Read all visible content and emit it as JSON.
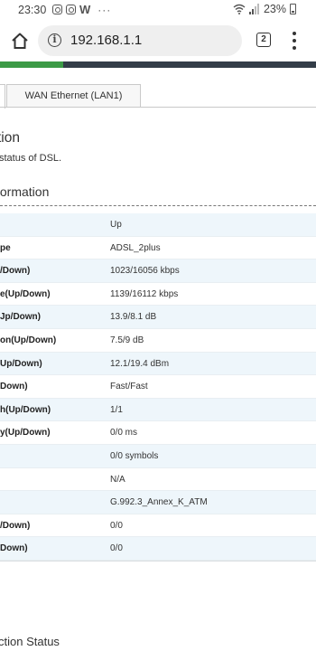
{
  "status_bar": {
    "time": "23:30",
    "app_icons": [
      "instagram-icon",
      "instagram-icon",
      "w-app-icon"
    ],
    "overflow": "···",
    "battery": "23%"
  },
  "browser": {
    "url": "192.168.1.1",
    "tab_count": "2",
    "load_progress_percent": 20,
    "colors": {
      "progress_fill": "#3c9a46",
      "progress_track": "#333d48"
    }
  },
  "tabs": [
    {
      "label": ""
    },
    {
      "label": "WAN Ethernet (LAN1)"
    }
  ],
  "page": {
    "title": "tion",
    "description": "status of DSL.",
    "section_title": "formation",
    "bottom_title": "ction Status"
  },
  "table": {
    "rows": [
      {
        "label": "",
        "value": "Up"
      },
      {
        "label": "pe",
        "value": "ADSL_2plus"
      },
      {
        "label": "/Down)",
        "value": "1023/16056 kbps"
      },
      {
        "label": "e(Up/Down)",
        "value": "1139/16112 kbps"
      },
      {
        "label": "Jp/Down)",
        "value": "13.9/8.1 dB"
      },
      {
        "label": "on(Up/Down)",
        "value": "7.5/9 dB"
      },
      {
        "label": "Up/Down)",
        "value": "12.1/19.4 dBm"
      },
      {
        "label": "Down)",
        "value": "Fast/Fast"
      },
      {
        "label": "h(Up/Down)",
        "value": "1/1"
      },
      {
        "label": "y(Up/Down)",
        "value": "0/0 ms"
      },
      {
        "label": "",
        "value": "0/0 symbols"
      },
      {
        "label": "",
        "value": "N/A"
      },
      {
        "label": "",
        "value": "G.992.3_Annex_K_ATM"
      },
      {
        "label": "/Down)",
        "value": "0/0"
      },
      {
        "label": "Down)",
        "value": "0/0"
      }
    ]
  }
}
